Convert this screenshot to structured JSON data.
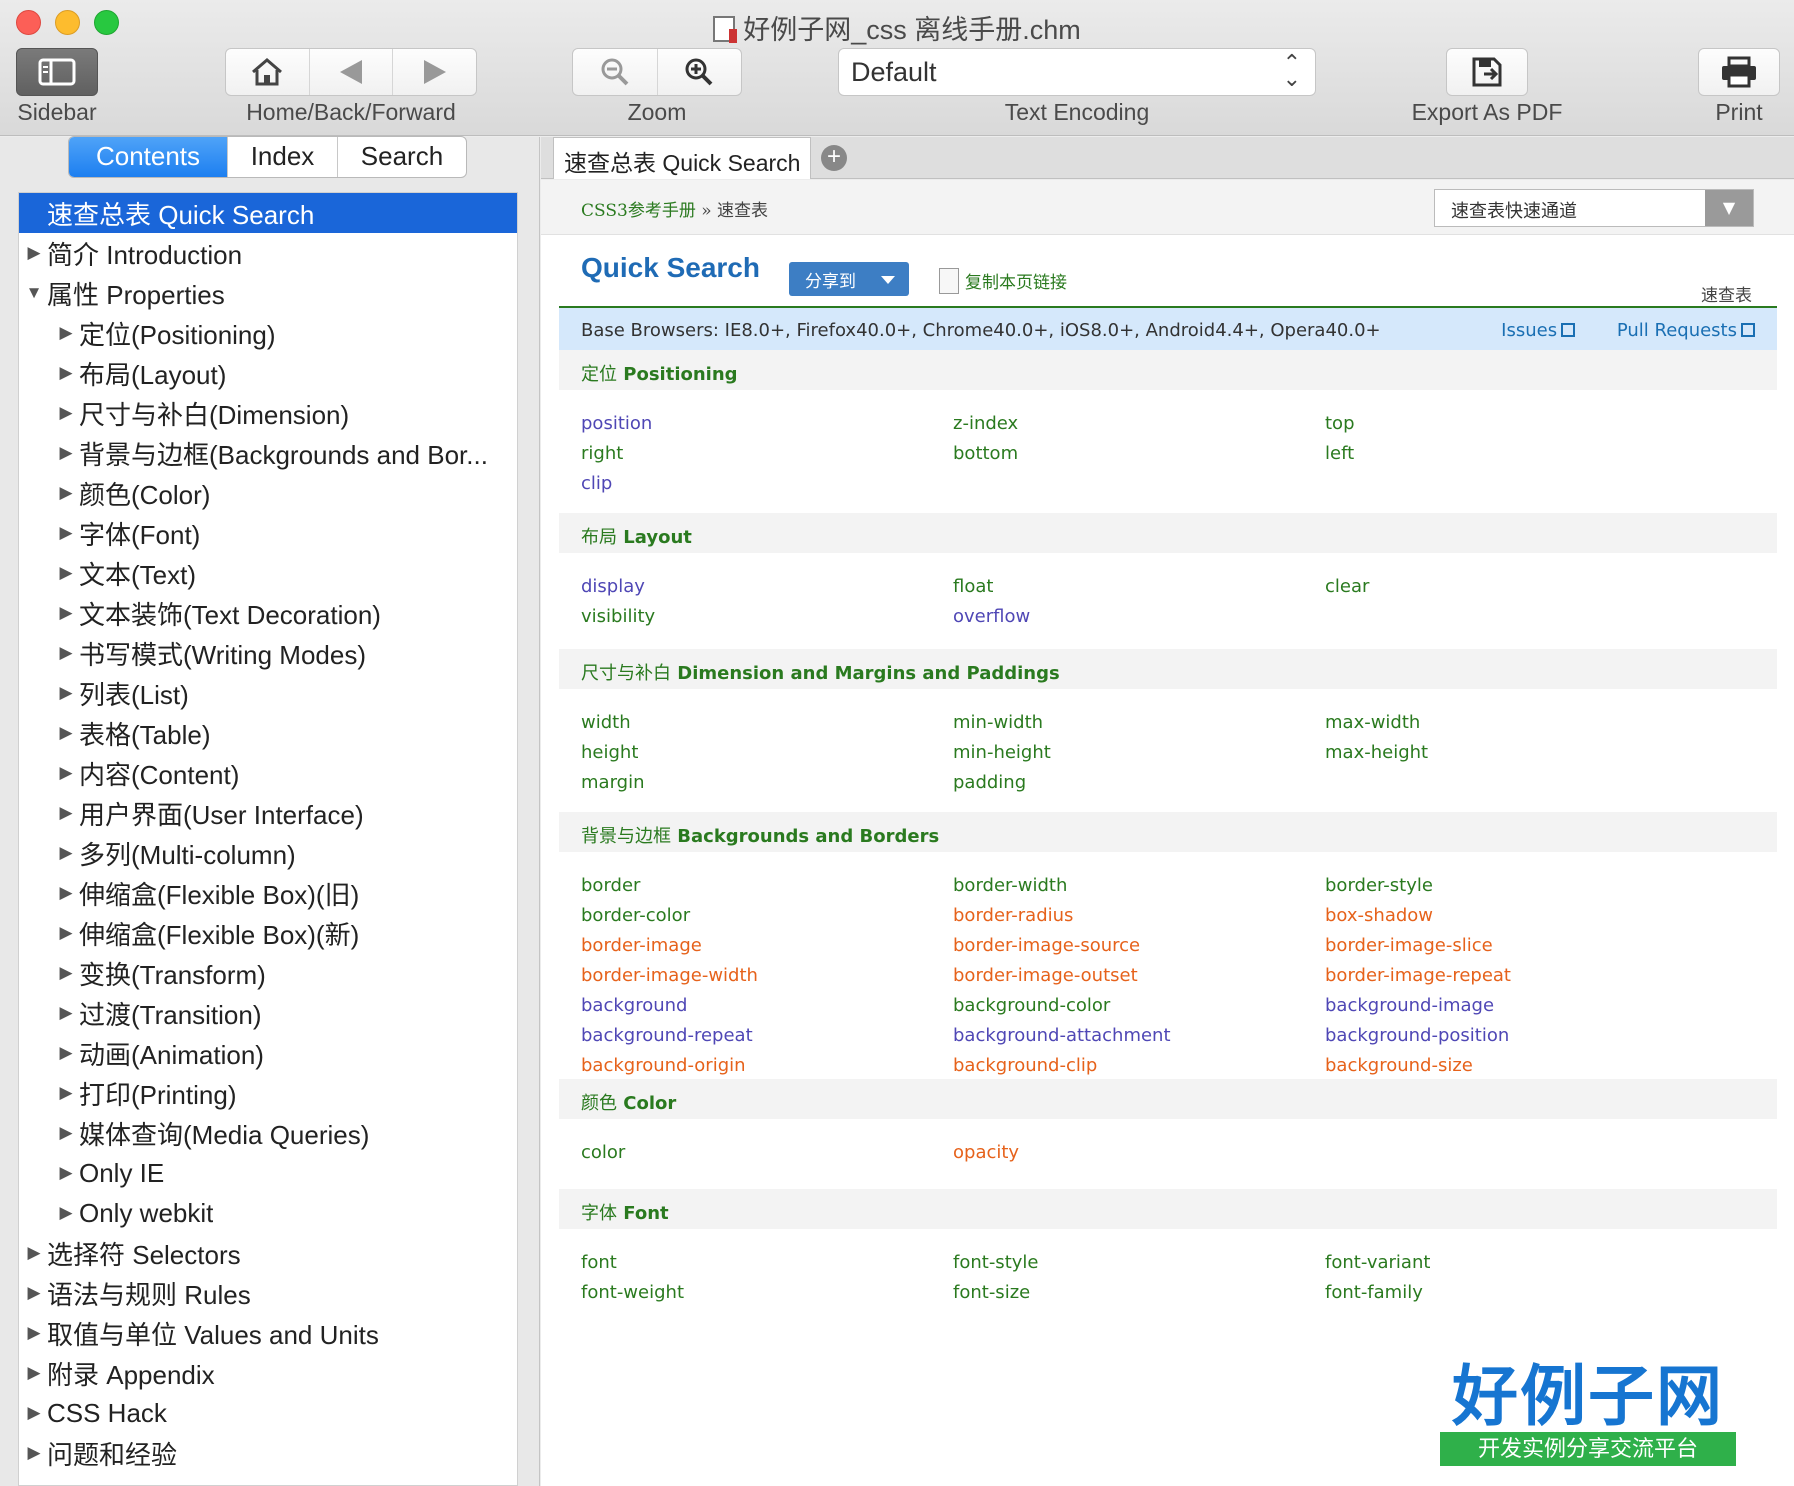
{
  "window": {
    "title": "好例子网_css 离线手册.chm"
  },
  "toolbar": {
    "sidebar_label": "Sidebar",
    "nav_label": "Home/Back/Forward",
    "zoom_label": "Zoom",
    "encoding_value": "Default",
    "encoding_label": "Text Encoding",
    "export_label": "Export As PDF",
    "print_label": "Print"
  },
  "sidebar": {
    "tabs": [
      "Contents",
      "Index",
      "Search"
    ],
    "tree": [
      {
        "label": "速查总表 Quick Search",
        "level": 0,
        "arrow": "",
        "active": true
      },
      {
        "label": "简介 Introduction",
        "level": 0,
        "arrow": "▶"
      },
      {
        "label": "属性 Properties",
        "level": 0,
        "arrow": "▼"
      },
      {
        "label": "定位(Positioning)",
        "level": 1,
        "arrow": "▶"
      },
      {
        "label": "布局(Layout)",
        "level": 1,
        "arrow": "▶"
      },
      {
        "label": "尺寸与补白(Dimension)",
        "level": 1,
        "arrow": "▶"
      },
      {
        "label": "背景与边框(Backgrounds and Bor...",
        "level": 1,
        "arrow": "▶"
      },
      {
        "label": "颜色(Color)",
        "level": 1,
        "arrow": "▶"
      },
      {
        "label": "字体(Font)",
        "level": 1,
        "arrow": "▶"
      },
      {
        "label": "文本(Text)",
        "level": 1,
        "arrow": "▶"
      },
      {
        "label": "文本装饰(Text Decoration)",
        "level": 1,
        "arrow": "▶"
      },
      {
        "label": "书写模式(Writing Modes)",
        "level": 1,
        "arrow": "▶"
      },
      {
        "label": "列表(List)",
        "level": 1,
        "arrow": "▶"
      },
      {
        "label": "表格(Table)",
        "level": 1,
        "arrow": "▶"
      },
      {
        "label": "内容(Content)",
        "level": 1,
        "arrow": "▶"
      },
      {
        "label": "用户界面(User Interface)",
        "level": 1,
        "arrow": "▶"
      },
      {
        "label": "多列(Multi-column)",
        "level": 1,
        "arrow": "▶"
      },
      {
        "label": "伸缩盒(Flexible Box)(旧)",
        "level": 1,
        "arrow": "▶"
      },
      {
        "label": "伸缩盒(Flexible Box)(新)",
        "level": 1,
        "arrow": "▶"
      },
      {
        "label": "变换(Transform)",
        "level": 1,
        "arrow": "▶"
      },
      {
        "label": "过渡(Transition)",
        "level": 1,
        "arrow": "▶"
      },
      {
        "label": "动画(Animation)",
        "level": 1,
        "arrow": "▶"
      },
      {
        "label": "打印(Printing)",
        "level": 1,
        "arrow": "▶"
      },
      {
        "label": "媒体查询(Media Queries)",
        "level": 1,
        "arrow": "▶"
      },
      {
        "label": "Only IE",
        "level": 1,
        "arrow": "▶"
      },
      {
        "label": "Only webkit",
        "level": 1,
        "arrow": "▶"
      },
      {
        "label": "选择符 Selectors",
        "level": 0,
        "arrow": "▶"
      },
      {
        "label": "语法与规则 Rules",
        "level": 0,
        "arrow": "▶"
      },
      {
        "label": "取值与单位 Values and Units",
        "level": 0,
        "arrow": "▶"
      },
      {
        "label": "附录 Appendix",
        "level": 0,
        "arrow": "▶"
      },
      {
        "label": "CSS Hack",
        "level": 0,
        "arrow": "▶"
      },
      {
        "label": "问题和经验",
        "level": 0,
        "arrow": "▶"
      }
    ]
  },
  "content": {
    "tab_label": "速查总表 Quick Search",
    "breadcrumb": {
      "root": "CSS3参考手册",
      "sep": "»",
      "current": "速查表"
    },
    "quick_select": "速查表快速通道",
    "title": "Quick Search",
    "share_label": "分享到",
    "copy_link_label": "复制本页链接",
    "page_tag": "速查表",
    "browsers": "Base Browsers: IE8.0+, Firefox40.0+, Chrome40.0+, iOS8.0+, Android4.4+, Opera40.0+",
    "issues_label": "Issues",
    "pull_requests_label": "Pull Requests",
    "colors": {
      "blue": "#4f47b5",
      "green": "#2a7a1f",
      "orange": "#e6621b"
    },
    "sections": [
      {
        "cn": "定位",
        "en": "Positioning",
        "props": [
          [
            "position",
            "blue"
          ],
          [
            "z-index",
            "green"
          ],
          [
            "top",
            "green"
          ],
          [
            "right",
            "green"
          ],
          [
            "bottom",
            "green"
          ],
          [
            "left",
            "green"
          ],
          [
            "clip",
            "blue"
          ]
        ]
      },
      {
        "cn": "布局",
        "en": "Layout",
        "props": [
          [
            "display",
            "blue"
          ],
          [
            "float",
            "green"
          ],
          [
            "clear",
            "green"
          ],
          [
            "visibility",
            "green"
          ],
          [
            "overflow",
            "blue"
          ]
        ]
      },
      {
        "cn": "尺寸与补白",
        "en": "Dimension and Margins and Paddings",
        "props": [
          [
            "width",
            "green"
          ],
          [
            "min-width",
            "green"
          ],
          [
            "max-width",
            "green"
          ],
          [
            "height",
            "green"
          ],
          [
            "min-height",
            "green"
          ],
          [
            "max-height",
            "green"
          ],
          [
            "margin",
            "green"
          ],
          [
            "padding",
            "green"
          ]
        ]
      },
      {
        "cn": "背景与边框",
        "en": "Backgrounds and Borders",
        "props": [
          [
            "border",
            "green"
          ],
          [
            "border-width",
            "green"
          ],
          [
            "border-style",
            "green"
          ],
          [
            "border-color",
            "green"
          ],
          [
            "border-radius",
            "orange"
          ],
          [
            "box-shadow",
            "orange"
          ],
          [
            "border-image",
            "orange"
          ],
          [
            "border-image-source",
            "orange"
          ],
          [
            "border-image-slice",
            "orange"
          ],
          [
            "border-image-width",
            "orange"
          ],
          [
            "border-image-outset",
            "orange"
          ],
          [
            "border-image-repeat",
            "orange"
          ],
          [
            "background",
            "blue"
          ],
          [
            "background-color",
            "green"
          ],
          [
            "background-image",
            "blue"
          ],
          [
            "background-repeat",
            "blue"
          ],
          [
            "background-attachment",
            "blue"
          ],
          [
            "background-position",
            "blue"
          ],
          [
            "background-origin",
            "orange"
          ],
          [
            "background-clip",
            "orange"
          ],
          [
            "background-size",
            "orange"
          ]
        ]
      },
      {
        "cn": "颜色",
        "en": "Color",
        "props": [
          [
            "color",
            "green"
          ],
          [
            "opacity",
            "orange"
          ]
        ]
      },
      {
        "cn": "字体",
        "en": "Font",
        "props": [
          [
            "font",
            "green"
          ],
          [
            "font-style",
            "green"
          ],
          [
            "font-variant",
            "green"
          ],
          [
            "font-weight",
            "green"
          ],
          [
            "font-size",
            "green"
          ],
          [
            "font-family",
            "green"
          ]
        ]
      }
    ]
  },
  "logo": {
    "main": "好例子网",
    "sub": "开发实例分享交流平台"
  }
}
